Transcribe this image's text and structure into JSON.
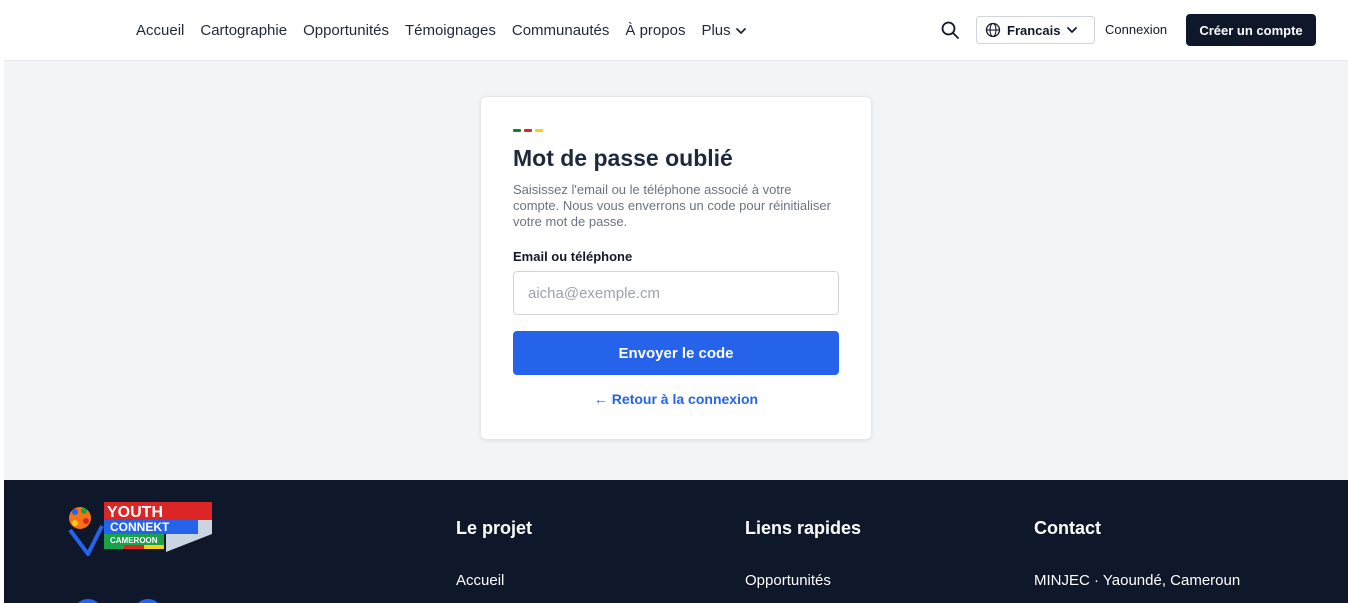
{
  "header": {
    "nav": [
      "Accueil",
      "Cartographie",
      "Opportunités",
      "Témoignages",
      "Communautés",
      "À propos"
    ],
    "more_label": "Plus",
    "language_label": "Francais",
    "login_label": "Connexion",
    "signup_label": "Créer un compte"
  },
  "card": {
    "flag_colors": [
      "#15803d",
      "#dc2626",
      "#facc15"
    ],
    "title": "Mot de passe oublié",
    "description": "Saisissez l'email ou le téléphone associé à votre compte. Nous vous enverrons un code pour réinitialiser votre mot de passe.",
    "field_label": "Email ou téléphone",
    "field_placeholder": "aicha@exemple.cm",
    "submit_label": "Envoyer le code",
    "back_label": "← Retour à la connexion"
  },
  "footer": {
    "logo": {
      "line1": "YOUTH",
      "line2": "CONNEKT",
      "line3": "CAMEROON"
    },
    "col_project": {
      "title": "Le projet",
      "item": "Accueil"
    },
    "col_links": {
      "title": "Liens rapides",
      "item": "Opportunités"
    },
    "col_contact": {
      "title": "Contact",
      "item": "MINJEC · Yaoundé, Cameroun"
    }
  },
  "colors": {
    "primary": "#2563eb",
    "dark": "#0f172a"
  }
}
